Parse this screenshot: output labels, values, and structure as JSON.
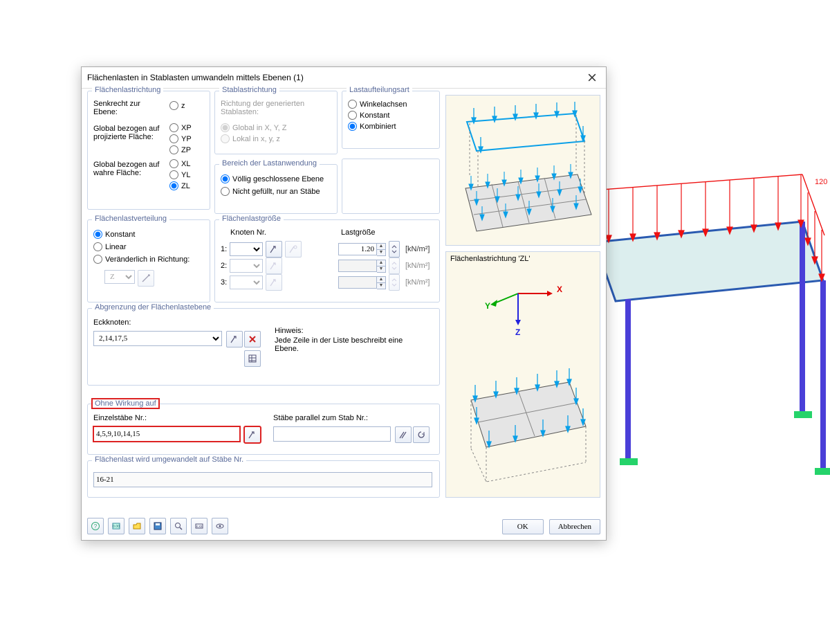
{
  "window": {
    "title": "Flächenlasten in Stablasten umwandeln mittels Ebenen   (1)"
  },
  "groups": {
    "flr": {
      "title": "Flächenlastrichtung",
      "senkrecht_label": "Senkrecht zur Ebene:",
      "z": "z",
      "proj_label": "Global bezogen auf projizierte Fläche:",
      "xp": "XP",
      "yp": "YP",
      "zp": "ZP",
      "wahr_label": "Global bezogen auf wahre Fläche:",
      "xl": "XL",
      "yl": "YL",
      "zl": "ZL"
    },
    "stb": {
      "title": "Stablastrichtung",
      "hint": "Richtung der generierten Stablasten:",
      "opt1": "Global in X, Y, Z",
      "opt2": "Lokal in x, y, z"
    },
    "bereich": {
      "title": "Bereich der Lastanwendung",
      "opt1": "Völlig geschlossene Ebene",
      "opt2": "Nicht gefüllt, nur an Stäbe"
    },
    "art": {
      "title": "Lastaufteilungsart",
      "opt1": "Winkelachsen",
      "opt2": "Konstant",
      "opt3": "Kombiniert"
    },
    "vert": {
      "title": "Flächenlastverteilung",
      "opt1": "Konstant",
      "opt2": "Linear",
      "opt3": "Veränderlich in Richtung:",
      "axis": "Z"
    },
    "groesse": {
      "title": "Flächenlastgröße",
      "knoten": "Knoten Nr.",
      "last": "Lastgröße",
      "r1": "1:",
      "r2": "2:",
      "r3": "3:",
      "v1": "1.20",
      "unit": "[kN/m²]"
    },
    "abg": {
      "title": "Abgrenzung der Flächenlastebene",
      "eck": "Eckknoten:",
      "value": "2,14,17,5",
      "hinweis_l": "Hinweis:",
      "hinweis": "Jede Zeile in der Liste beschreibt eine Ebene."
    },
    "ohne": {
      "title": "Ohne Wirkung auf",
      "einzel_l": "Einzelstäbe Nr.:",
      "einzel_v": "4,5,9,10,14,15",
      "parallel_l": "Stäbe parallel zum Stab Nr.:"
    },
    "umg": {
      "title": "Flächenlast wird umgewandelt auf Stäbe Nr.",
      "value": "16-21"
    }
  },
  "preview2_label": "Flächenlastrichtung 'ZL'",
  "axes": {
    "x": "X",
    "y": "Y",
    "z": "Z"
  },
  "buttons": {
    "ok": "OK",
    "cancel": "Abbrechen"
  },
  "bg_load": "120"
}
